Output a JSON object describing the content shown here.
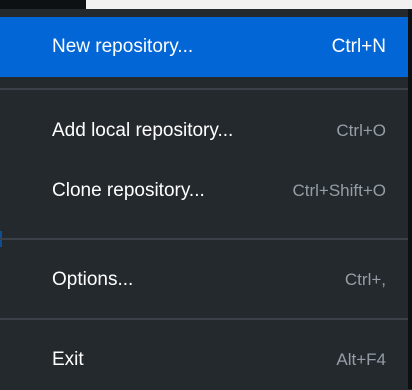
{
  "menu": {
    "items": [
      {
        "label": "New repository...",
        "shortcut": "Ctrl+N"
      },
      {
        "label": "Add local repository...",
        "shortcut": "Ctrl+O"
      },
      {
        "label": "Clone repository...",
        "shortcut": "Ctrl+Shift+O"
      },
      {
        "label": "Options...",
        "shortcut": "Ctrl+,"
      },
      {
        "label": "Exit",
        "shortcut": "Alt+F4"
      }
    ]
  },
  "colors": {
    "menu_background": "#24292e",
    "highlight": "#0366d6",
    "text": "#ffffff",
    "shortcut_text": "#959da5",
    "separator": "#3b4148"
  }
}
